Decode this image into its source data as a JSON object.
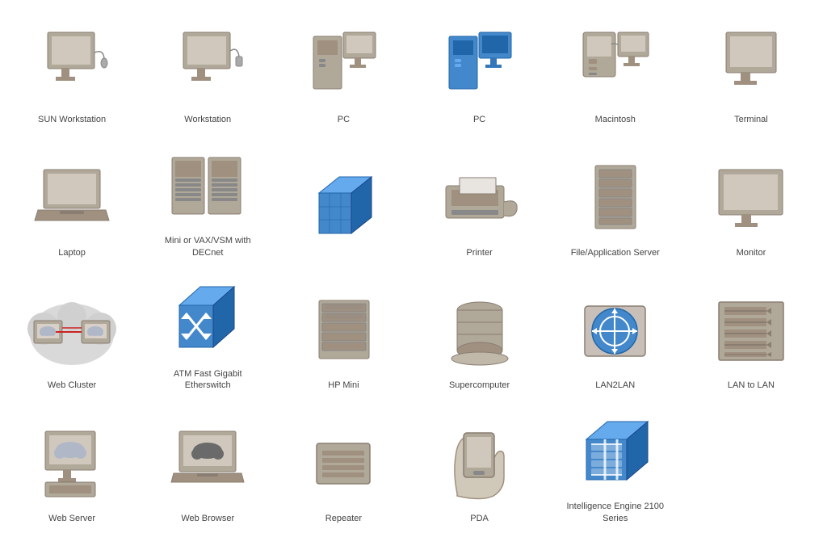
{
  "items": [
    {
      "id": "sun-workstation",
      "label": "SUN Workstation",
      "type": "sun-workstation"
    },
    {
      "id": "workstation",
      "label": "Workstation",
      "type": "workstation"
    },
    {
      "id": "pc-gray",
      "label": "PC",
      "type": "pc-gray"
    },
    {
      "id": "pc-blue",
      "label": "PC",
      "type": "pc-blue"
    },
    {
      "id": "macintosh",
      "label": "Macintosh",
      "type": "macintosh"
    },
    {
      "id": "terminal",
      "label": "Terminal",
      "type": "terminal"
    },
    {
      "id": "laptop",
      "label": "Laptop",
      "type": "laptop"
    },
    {
      "id": "mini-vax",
      "label": "Mini or VAX/VSM with DECnet",
      "type": "mini-vax"
    },
    {
      "id": "blue-cube",
      "label": "",
      "type": "blue-cube"
    },
    {
      "id": "printer",
      "label": "Printer",
      "type": "printer"
    },
    {
      "id": "file-server",
      "label": "File/Application Server",
      "type": "file-server"
    },
    {
      "id": "monitor",
      "label": "Monitor",
      "type": "monitor"
    },
    {
      "id": "web-cluster",
      "label": "Web Cluster",
      "type": "web-cluster"
    },
    {
      "id": "atm-switch",
      "label": "ATM Fast Gigabit Etherswitch",
      "type": "atm-switch"
    },
    {
      "id": "hp-mini",
      "label": "HP Mini",
      "type": "hp-mini"
    },
    {
      "id": "supercomputer",
      "label": "Supercomputer",
      "type": "supercomputer"
    },
    {
      "id": "lan2lan",
      "label": "LAN2LAN",
      "type": "lan2lan"
    },
    {
      "id": "lan-to-lan",
      "label": "LAN to LAN",
      "type": "lan-to-lan"
    },
    {
      "id": "web-server",
      "label": "Web Server",
      "type": "web-server"
    },
    {
      "id": "web-browser",
      "label": "Web Browser",
      "type": "web-browser"
    },
    {
      "id": "repeater",
      "label": "Repeater",
      "type": "repeater"
    },
    {
      "id": "pda",
      "label": "PDA",
      "type": "pda"
    },
    {
      "id": "intelligence-engine",
      "label": "Intelligence Engine 2100 Series",
      "type": "intelligence-engine"
    }
  ]
}
